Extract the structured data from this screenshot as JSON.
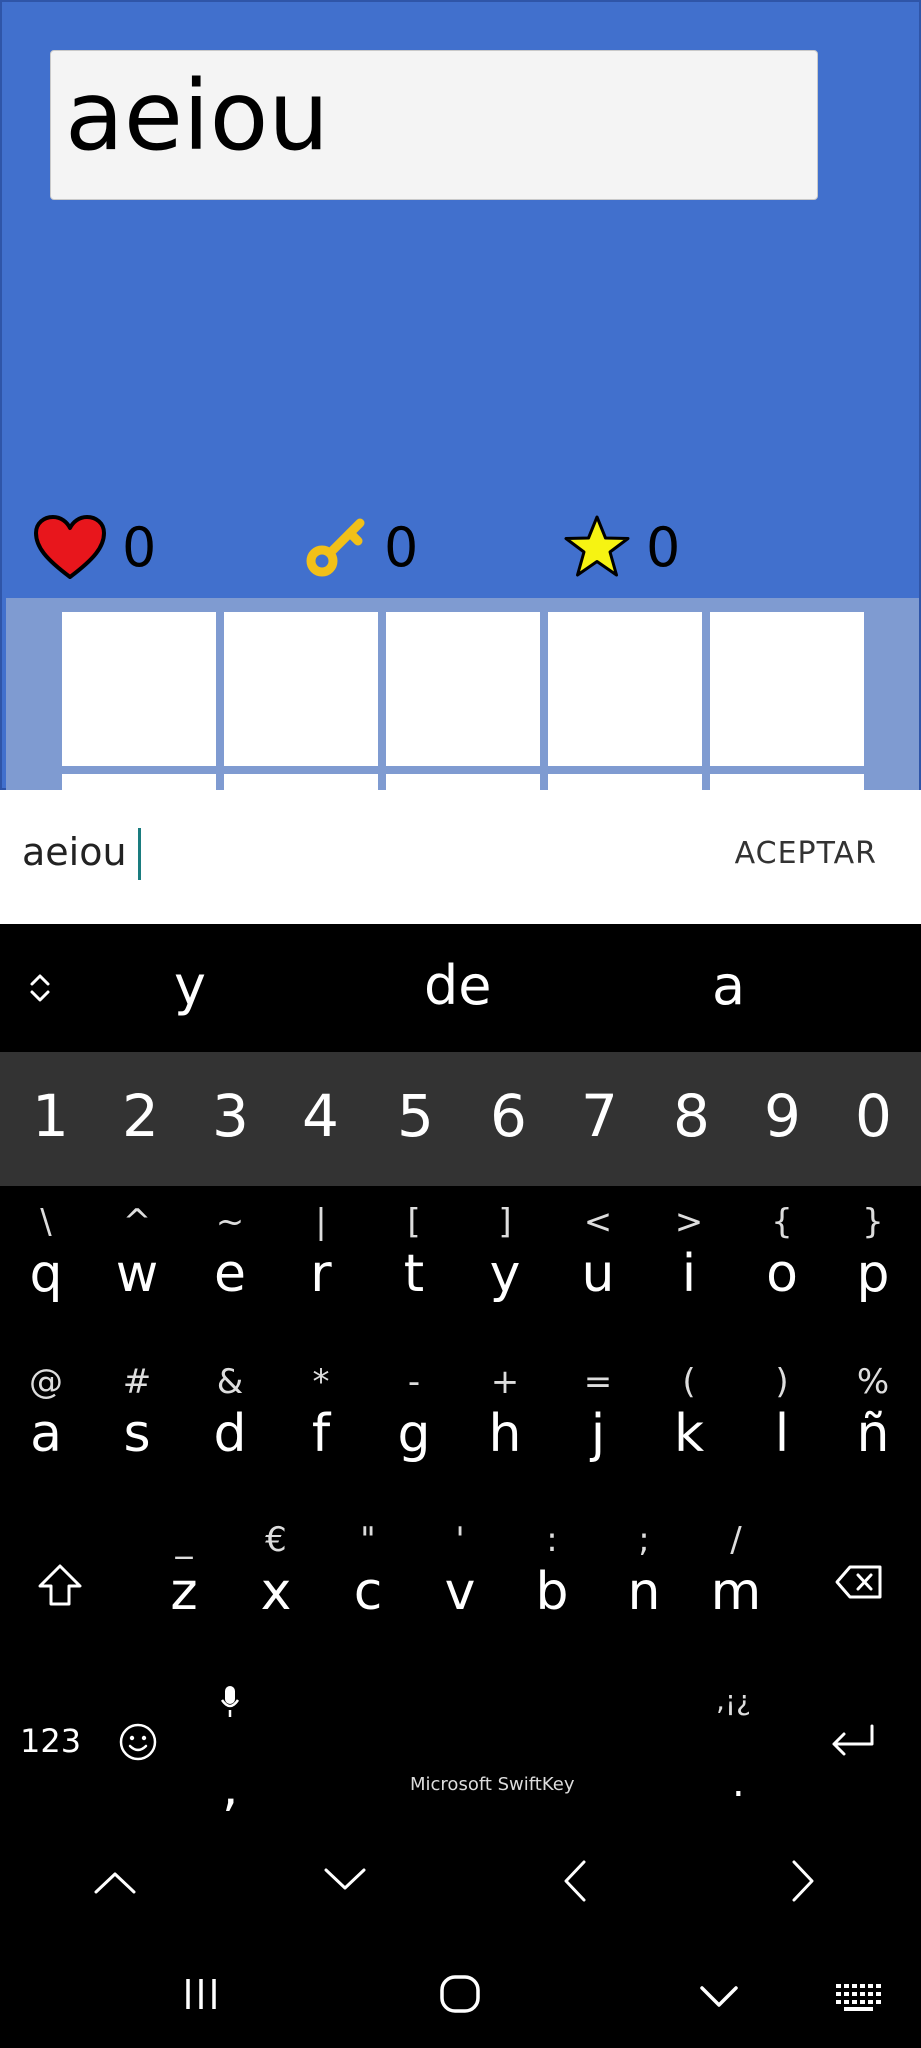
{
  "game": {
    "word": "aeiou",
    "hearts": "0",
    "keys": "0",
    "stars": "0"
  },
  "input": {
    "value": "aeiou",
    "accept_label": "ACEPTAR"
  },
  "keyboard": {
    "suggestions": [
      "y",
      "de",
      "a"
    ],
    "numbers": [
      "1",
      "2",
      "3",
      "4",
      "5",
      "6",
      "7",
      "8",
      "9",
      "0"
    ],
    "row1": [
      {
        "sec": "\\",
        "main": "q"
      },
      {
        "sec": "^",
        "main": "w"
      },
      {
        "sec": "~",
        "main": "e"
      },
      {
        "sec": "|",
        "main": "r"
      },
      {
        "sec": "[",
        "main": "t"
      },
      {
        "sec": "]",
        "main": "y"
      },
      {
        "sec": "<",
        "main": "u"
      },
      {
        "sec": ">",
        "main": "i"
      },
      {
        "sec": "{",
        "main": "o"
      },
      {
        "sec": "}",
        "main": "p"
      }
    ],
    "row2": [
      {
        "sec": "@",
        "main": "a"
      },
      {
        "sec": "#",
        "main": "s"
      },
      {
        "sec": "&",
        "main": "d"
      },
      {
        "sec": "*",
        "main": "f"
      },
      {
        "sec": "-",
        "main": "g"
      },
      {
        "sec": "+",
        "main": "h"
      },
      {
        "sec": "=",
        "main": "j"
      },
      {
        "sec": "(",
        "main": "k"
      },
      {
        "sec": ")",
        "main": "l"
      },
      {
        "sec": "%",
        "main": "ñ"
      }
    ],
    "row3": [
      {
        "sec": "_",
        "main": "z"
      },
      {
        "sec": "€",
        "main": "x"
      },
      {
        "sec": "\"",
        "main": "c"
      },
      {
        "sec": "'",
        "main": "v"
      },
      {
        "sec": ":",
        "main": "b"
      },
      {
        "sec": ";",
        "main": "n"
      },
      {
        "sec": "/",
        "main": "m"
      }
    ],
    "mode_label": "123",
    "comma": ",",
    "period": ".",
    "punct_label": ",¡¿",
    "brand": "Microsoft SwiftKey"
  },
  "colors": {
    "game_bg": "#4170cd",
    "grid_bg": "#7f9bd1",
    "heart": "#e8161c",
    "key": "#f2c018",
    "star": "#f6f312",
    "caret": "#1a7c7f"
  }
}
